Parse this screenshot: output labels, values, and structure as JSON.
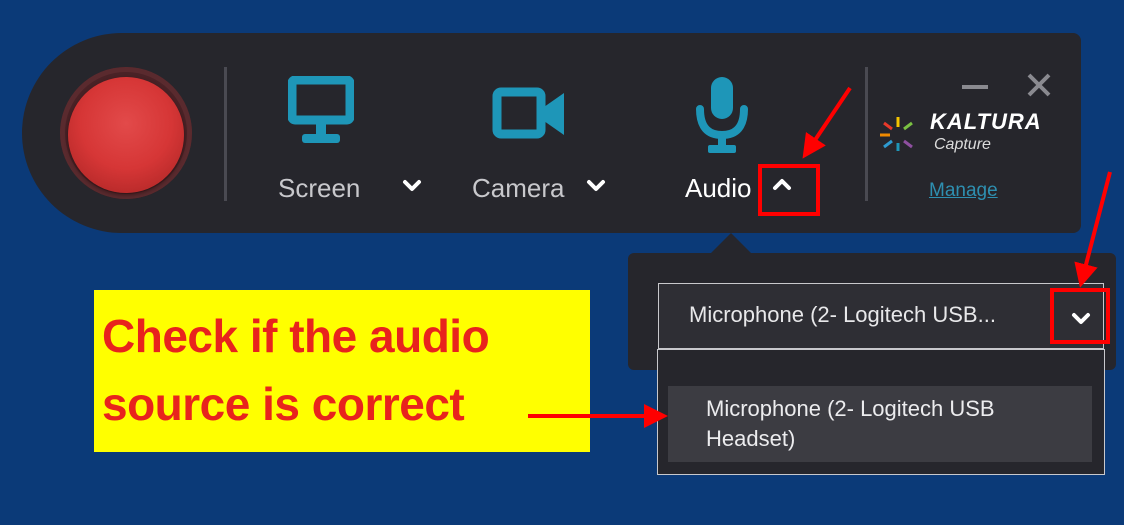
{
  "toolbar": {
    "sources": [
      {
        "label": "Screen",
        "icon": "monitor-icon",
        "chevron": "chevron-down-icon"
      },
      {
        "label": "Camera",
        "icon": "video-camera-icon",
        "chevron": "chevron-down-icon"
      },
      {
        "label": "Audio",
        "icon": "microphone-icon",
        "chevron": "chevron-up-icon"
      }
    ],
    "brand": {
      "name": "KALTURA",
      "sub": "Capture",
      "manage": "Manage"
    }
  },
  "audio_popup": {
    "selected": "Microphone (2- Logitech USB...",
    "options": [
      "Microphone (2- Logitech USB Headset)"
    ]
  },
  "annotation": {
    "text": "Check if the audio\nsource is correct"
  },
  "colors": {
    "background": "#0b3a78",
    "toolbar": "#26262c",
    "icon_teal": "#1e96b8",
    "record": "#d63636",
    "annotation_bg": "#ffff00",
    "annotation_text": "#e8231d",
    "highlight": "#ff0000"
  }
}
